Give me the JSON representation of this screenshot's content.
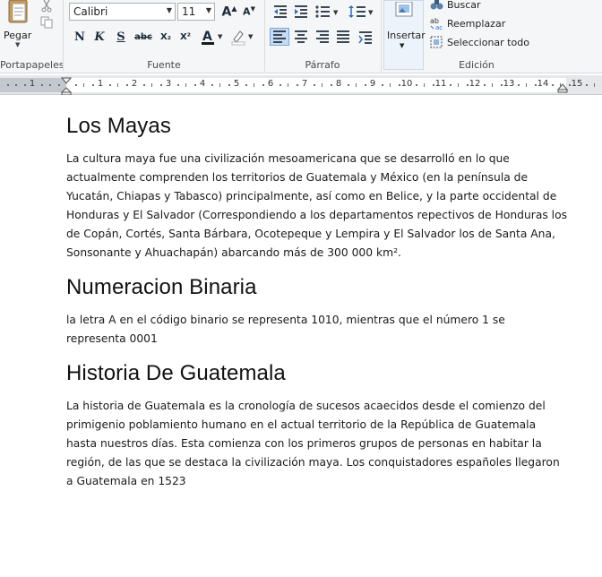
{
  "ribbon": {
    "groups": {
      "clipboard": "Portapapeles",
      "font": "Fuente",
      "paragraph": "Párrafo",
      "editing": "Edición"
    },
    "paste_label": "Pegar",
    "font_family": "Calibri",
    "font_size": "11",
    "insert_label": "Insertar",
    "find_label": "Buscar",
    "replace_label": "Reemplazar",
    "select_all_label": "Seleccionar todo",
    "format_buttons": [
      "N",
      "K",
      "S",
      "abc",
      "X₂",
      "X²"
    ]
  },
  "ruler": {
    "numbers": [
      "1",
      "1",
      "2",
      "3",
      "4",
      "5",
      "6",
      "7",
      "8",
      "9",
      "10",
      "11",
      "12",
      "13",
      "14",
      "15"
    ]
  },
  "document": {
    "sections": [
      {
        "heading": "Los Mayas",
        "paragraph": "La cultura maya fue una civilización mesoamericana que se desarrolló en lo que actualmente comprenden los territorios de Guatemala y México (en la península de Yucatán, Chiapas y Tabasco) principalmente, así como en Belice, y la parte occidental de Honduras y El Salvador (Correspondiendo a los departamentos repectivos de Honduras los de Copán, Cortés, Santa Bárbara, Ocotepeque y Lempira y El Salvador los de Santa Ana, Sonsonante y Ahuachapán) abarcando más de 300 000 km²."
      },
      {
        "heading": "Numeracion Binaria",
        "paragraph": "la letra A en el código binario se representa 1010, mientras que el número 1 se representa 0001"
      },
      {
        "heading": "Historia De Guatemala",
        "paragraph": "La historia de Guatemala es la cronología de sucesos acaecidos desde el comienzo del primigenio poblamiento humano en el actual territorio de la República de Guatemala hasta nuestros días. Esta comienza con los primeros grupos de personas en habitar la región, de las que se destaca la civilización maya. Los conquistadores españoles llegaron a Guatemala en 1523"
      }
    ]
  }
}
